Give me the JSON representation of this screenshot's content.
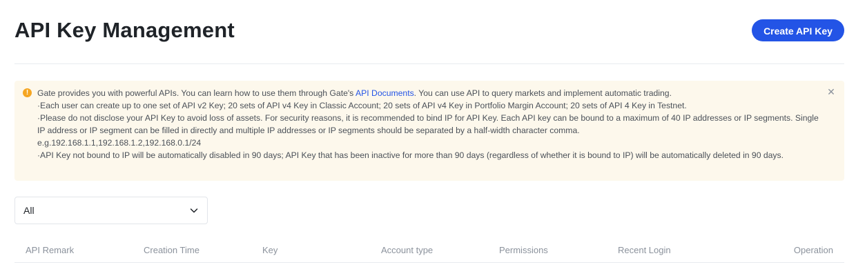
{
  "header": {
    "title": "API Key Management",
    "create_button": "Create API Key"
  },
  "notice": {
    "icon": "warning-icon",
    "line1_before": "Gate provides you with powerful APIs. You can learn how to use them through Gate's ",
    "line1_link": "API Documents",
    "line1_after": ". You can use API to query markets and implement automatic trading.",
    "line2": "·Each user can create up to one set of API v2 Key; 20 sets of API v4 Key in Classic Account; 20 sets of API v4 Key in Portfolio Margin Account; 20 sets of API 4 Key in Testnet.",
    "line3": "·Please do not disclose your API Key to avoid loss of assets. For security reasons, it is recommended to bind IP for API Key. Each API key can be bound to a maximum of 40 IP addresses or IP segments. Single IP address or IP segment can be filled in directly and multiple IP addresses or IP segments should be separated by a half-width character comma.",
    "line4": "e.g.192.168.1.1,192.168.1.2,192.168.0.1/24",
    "line5": "·API Key not bound to IP will be automatically disabled in 90 days; API Key that has been inactive for more than 90 days (regardless of whether it is bound to IP) will be automatically deleted in 90 days."
  },
  "filter": {
    "selected": "All"
  },
  "table": {
    "columns": [
      "API Remark",
      "Creation Time",
      "Key",
      "Account type",
      "Permissions",
      "Recent Login",
      "Operation"
    ]
  },
  "colors": {
    "accent": "#2354e6",
    "notice_bg": "#fdf8ec",
    "warning": "#f5a623"
  }
}
